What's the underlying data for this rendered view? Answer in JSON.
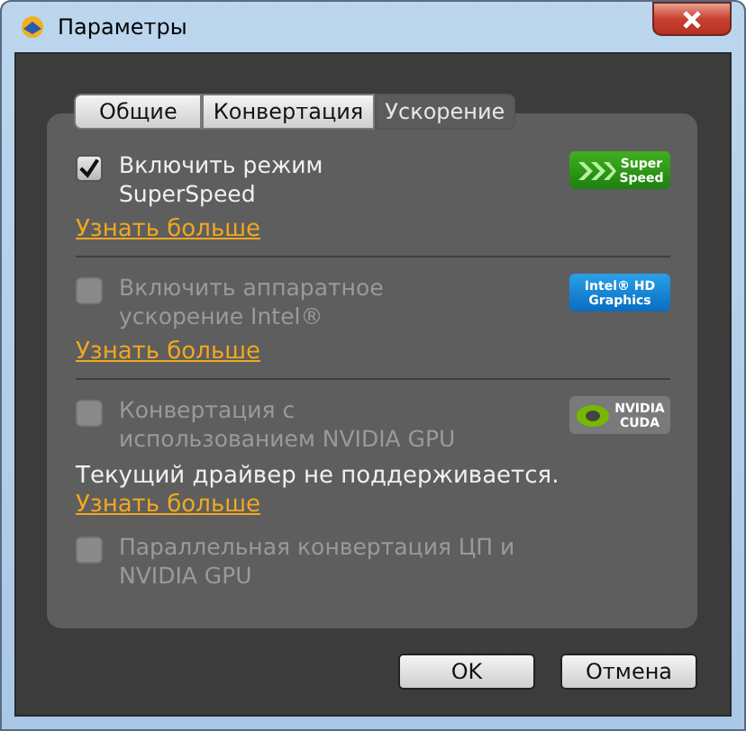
{
  "window": {
    "title": "Параметры"
  },
  "tabs": [
    {
      "label": "Общие",
      "selected": false
    },
    {
      "label": "Конвертация",
      "selected": false
    },
    {
      "label": "Ускорение",
      "selected": true
    }
  ],
  "options": [
    {
      "label": "Включить режим SuperSpeed",
      "checked": true,
      "disabled": false,
      "separated": true,
      "badge": {
        "kind": "superspeed",
        "lines": [
          "Super",
          "Speed"
        ]
      },
      "link": "Узнать больше"
    },
    {
      "label": "Включить аппаратное ускорение Intel®",
      "checked": false,
      "disabled": true,
      "separated": true,
      "badge": {
        "kind": "intel",
        "lines": [
          "Intel® HD",
          "Graphics"
        ]
      },
      "link": "Узнать больше"
    },
    {
      "label": "Конвертация с использованием NVIDIA GPU",
      "checked": false,
      "disabled": true,
      "separated": false,
      "badge": {
        "kind": "nvidia",
        "lines": [
          "NVIDIA",
          "CUDA"
        ]
      },
      "note": "Текущий драйвер не поддерживается.",
      "link": "Узнать больше"
    },
    {
      "label": "Параллельная конвертация ЦП и NVIDIA GPU",
      "checked": false,
      "disabled": true,
      "separated": false
    }
  ],
  "buttons": [
    "OK",
    "Отмена"
  ]
}
